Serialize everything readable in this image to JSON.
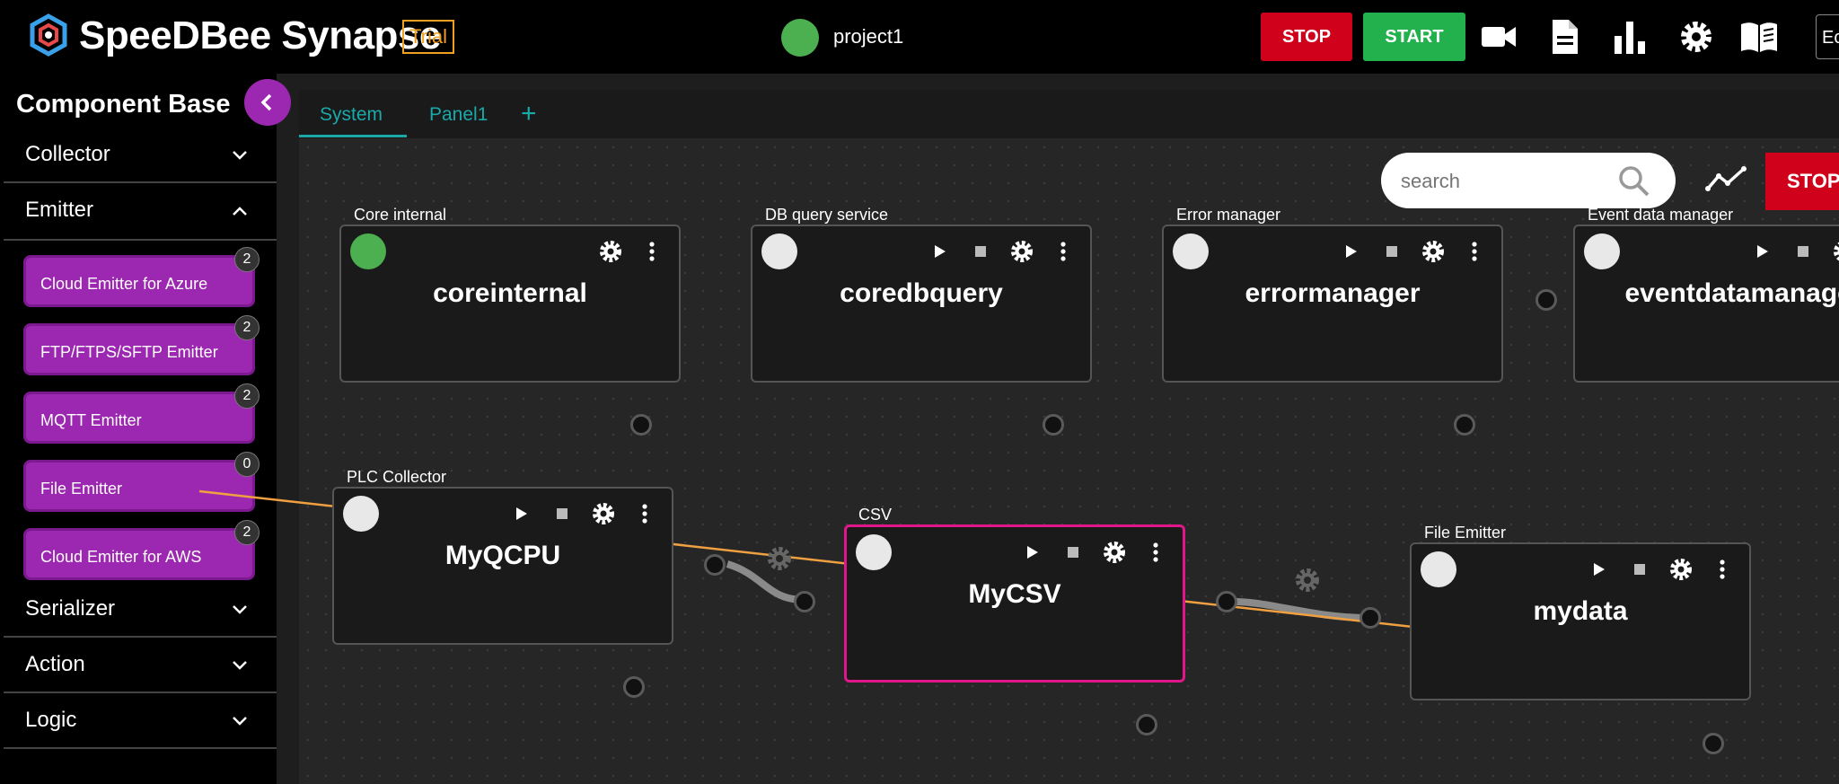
{
  "header": {
    "brand": "SpeeDBee Synapse",
    "trial_label": "Trial",
    "project_name": "project1",
    "stop_label": "STOP",
    "start_label": "START",
    "edge_label": "Ec",
    "icons": [
      "video-camera-icon",
      "document-icon",
      "bar-chart-icon",
      "gear-icon",
      "book-icon"
    ]
  },
  "sidebar": {
    "title": "Component Base",
    "sections": [
      {
        "label": "Collector",
        "expanded": false
      },
      {
        "label": "Emitter",
        "expanded": true
      },
      {
        "label": "Serializer",
        "expanded": false
      },
      {
        "label": "Action",
        "expanded": false
      },
      {
        "label": "Logic",
        "expanded": false
      }
    ],
    "emitter_items": [
      {
        "label": "Cloud Emitter for Azure",
        "count": "2"
      },
      {
        "label": "FTP/FTPS/SFTP Emitter",
        "count": "2"
      },
      {
        "label": "MQTT Emitter",
        "count": "2"
      },
      {
        "label": "File Emitter",
        "count": "0"
      },
      {
        "label": "Cloud Emitter for AWS",
        "count": "2"
      }
    ]
  },
  "tabs": [
    {
      "label": "System",
      "active": true
    },
    {
      "label": "Panel1",
      "active": false
    }
  ],
  "toolbar": {
    "search_placeholder": "search",
    "stop_label": "STOP"
  },
  "nodes": [
    {
      "caption": "Core internal",
      "name": "coreinternal",
      "status": "running"
    },
    {
      "caption": "DB query service",
      "name": "coredbquery",
      "status": "stopped"
    },
    {
      "caption": "Error manager",
      "name": "errormanager",
      "status": "stopped"
    },
    {
      "caption": "Event data manager",
      "name": "eventdatamanager",
      "status": "stopped"
    },
    {
      "caption": "PLC Collector",
      "name": "MyQCPU",
      "status": "stopped"
    },
    {
      "caption": "CSV",
      "name": "MyCSV",
      "status": "stopped",
      "selected": true
    },
    {
      "caption": "File Emitter",
      "name": "mydata",
      "status": "stopped"
    }
  ],
  "colors": {
    "accent_purple": "#9c27b0",
    "stop_red": "#d0021b",
    "start_green": "#22b14c",
    "tab_teal": "#1aa9a9",
    "selection_pink": "#e0168a",
    "running_green": "#4caf50",
    "drag_arrow": "#f0a040"
  }
}
